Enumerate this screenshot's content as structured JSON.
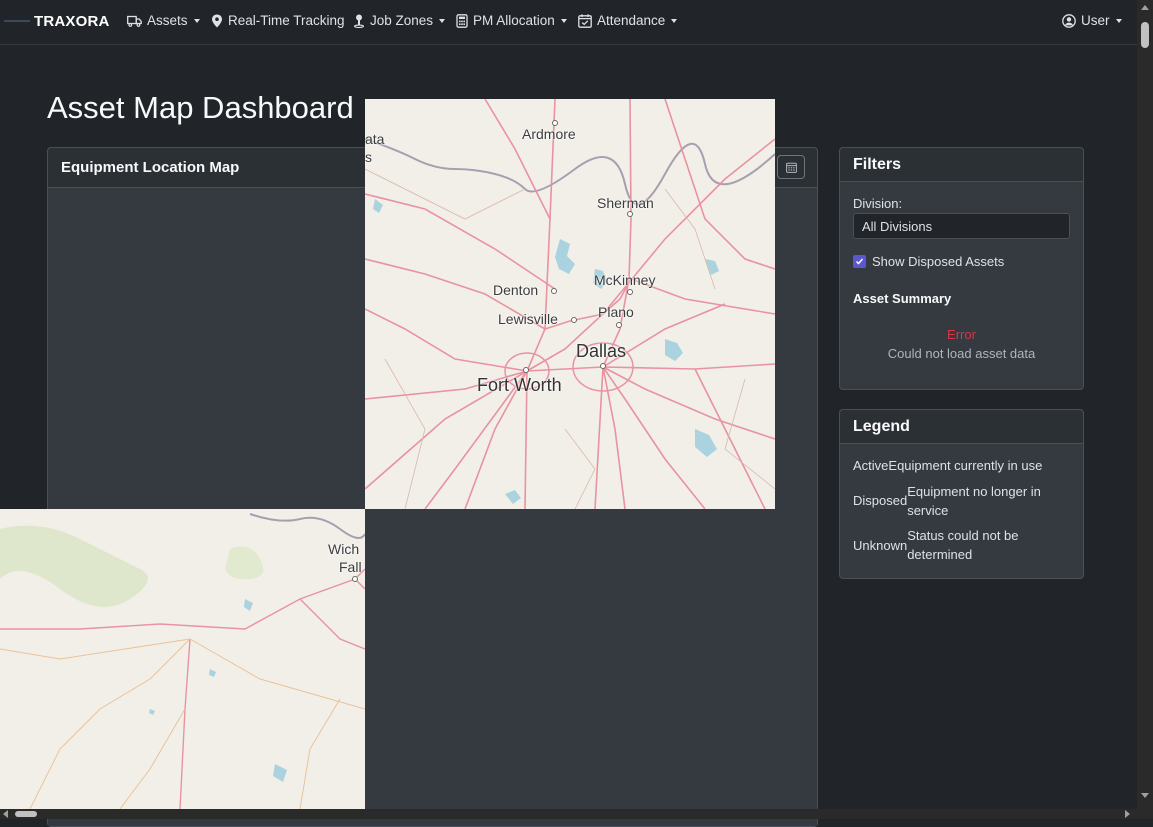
{
  "navbar": {
    "brand": "TRAXORA",
    "items": [
      {
        "label": "Assets",
        "icon": "truck-icon",
        "dropdown": true
      },
      {
        "label": "Real-Time Tracking",
        "icon": "map-pin-icon",
        "dropdown": false
      },
      {
        "label": "Job Zones",
        "icon": "person-pin-icon",
        "dropdown": true
      },
      {
        "label": "PM Allocation",
        "icon": "calculator-icon",
        "dropdown": true
      },
      {
        "label": "Attendance",
        "icon": "calendar-check-icon",
        "dropdown": true
      }
    ],
    "user_label": "User"
  },
  "page": {
    "title": "Asset Map Dashboard"
  },
  "map_card": {
    "title": "Equipment Location Map",
    "action_icon": "calendar-icon",
    "cities": {
      "ardmore": "Ardmore",
      "ata": "ata",
      "s": "s",
      "sherman": "Sherman",
      "mckinney": "McKinney",
      "denton": "Denton",
      "lewisville": "Lewisville",
      "plano": "Plano",
      "dallas": "Dallas",
      "fort_worth": "Fort Worth",
      "wich": "Wich",
      "fall": "Fall"
    }
  },
  "filters": {
    "title": "Filters",
    "division_label": "Division:",
    "division_value": "All Divisions",
    "show_disposed_label": "Show Disposed Assets",
    "show_disposed_checked": true,
    "summary_title": "Asset Summary",
    "error_title": "Error",
    "error_message": "Could not load asset data"
  },
  "legend": {
    "title": "Legend",
    "rows": [
      {
        "key": "Active",
        "desc": "Equipment currently in use"
      },
      {
        "key": "Disposed",
        "desc": "Equipment no longer in service"
      },
      {
        "key": "Unknown",
        "desc": "Status could not be determined"
      }
    ]
  },
  "colors": {
    "background": "#212529",
    "card": "#343a40",
    "accent_checkbox": "#5b57d1",
    "error": "#dc3545",
    "map_land": "#f2efe9",
    "map_road": "#e892a2",
    "map_water": "#aad3df"
  }
}
